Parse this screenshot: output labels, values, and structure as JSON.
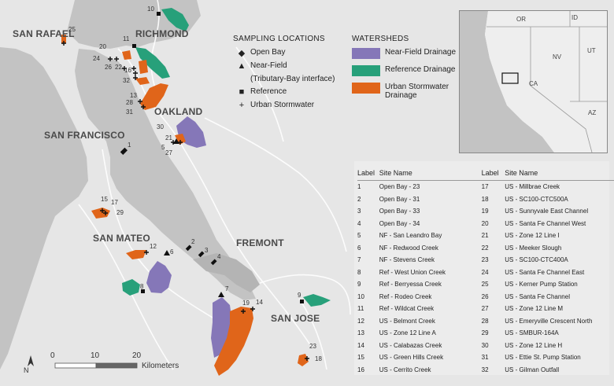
{
  "cities": {
    "san_rafael": "SAN RAFAEL",
    "richmond": "RICHMOND",
    "oakland": "OAKLAND",
    "san_francisco": "SAN FRANCISCO",
    "san_mateo": "SAN MATEO",
    "fremont": "FREMONT",
    "san_jose": "SAN JOSE"
  },
  "legend": {
    "sampling_title": "SAMPLING LOCATIONS",
    "open_bay": "Open Bay",
    "near_field": "Near-Field",
    "near_field_sub": "(Tributary-Bay interface)",
    "reference": "Reference",
    "urban_stormwater": "Urban Stormwater",
    "watersheds_title": "WATERSHEDS",
    "near_field_drainage": "Near-Field Drainage",
    "reference_drainage": "Reference Drainage",
    "urban_drainage_1": "Urban Stormwater",
    "urban_drainage_2": "Drainage"
  },
  "colors": {
    "near_field": "#8577b8",
    "reference": "#27a07a",
    "urban": "#e0651a",
    "water": "#bdbdbd",
    "land": "#e6e6e6"
  },
  "point_labels": {
    "p1": "1",
    "p2": "2",
    "p3": "3",
    "p4": "4",
    "p5": "5",
    "p6": "6",
    "p7": "7",
    "p8": "8",
    "p9": "9",
    "p10": "10",
    "p11": "11",
    "p12": "12",
    "p13": "13",
    "p14": "14",
    "p15": "15",
    "p16": "16",
    "p17": "17",
    "p18": "18",
    "p19": "19",
    "p20": "20",
    "p21": "21",
    "p22": "22",
    "p23": "23",
    "p24": "24",
    "p25": "25",
    "p26": "26",
    "p27": "27",
    "p28": "28",
    "p29": "29",
    "p30": "30",
    "p31": "31",
    "p32": "32"
  },
  "inset": {
    "or": "OR",
    "id": "ID",
    "nv": "NV",
    "ut": "UT",
    "ca": "CA",
    "az": "AZ"
  },
  "scale": {
    "zero": "0",
    "ten": "10",
    "twenty": "20",
    "units": "Kilometers",
    "north": "N"
  },
  "table": {
    "head_label": "Label",
    "head_site": "Site Name",
    "rows": [
      [
        "1",
        "Open Bay - 23",
        "17",
        "US - Millbrae Creek"
      ],
      [
        "2",
        "Open Bay - 31",
        "18",
        "US - SC100-CTC500A"
      ],
      [
        "3",
        "Open Bay - 33",
        "19",
        "US - Sunnyvale East Channel"
      ],
      [
        "4",
        "Open Bay - 34",
        "20",
        "US - Santa Fe Channel West"
      ],
      [
        "5",
        "NF - San Leandro Bay",
        "21",
        "US - Zone 12 Line I"
      ],
      [
        "6",
        "NF - Redwood Creek",
        "22",
        "US - Meeker Slough"
      ],
      [
        "7",
        "NF - Stevens Creek",
        "23",
        "US - SC100-CTC400A"
      ],
      [
        "8",
        "Ref - West Union Creek",
        "24",
        "US - Santa Fe Channel East"
      ],
      [
        "9",
        "Ref - Berryessa Creek",
        "25",
        "US - Kerner Pump Station"
      ],
      [
        "10",
        "Ref - Rodeo Creek",
        "26",
        "US - Santa Fe Channel"
      ],
      [
        "11",
        "Ref - Wildcat Creek",
        "27",
        "US - Zone 12 Line M"
      ],
      [
        "12",
        "US - Belmont Creek",
        "28",
        "US - Emeryville Crescent North"
      ],
      [
        "13",
        "US - Zone 12 Line A",
        "29",
        "US - SMBUR-164A"
      ],
      [
        "14",
        "US - Calabazas Creek",
        "30",
        "US - Zone 12 Line H"
      ],
      [
        "15",
        "US - Green Hills Creek",
        "31",
        "US - Ettie St. Pump Station"
      ],
      [
        "16",
        "US - Cerrito Creek",
        "32",
        "US - Gilman Outfall"
      ]
    ]
  }
}
